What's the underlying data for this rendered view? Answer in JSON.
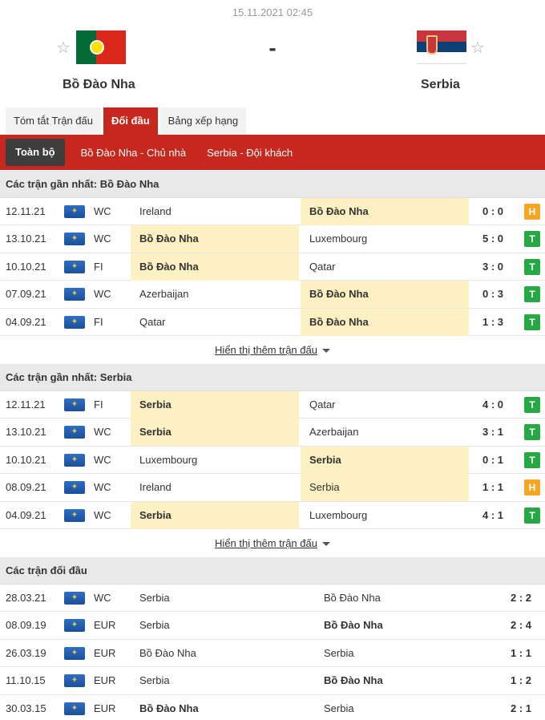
{
  "match": {
    "datetime": "15.11.2021 02:45",
    "home": "Bồ Đào Nha",
    "away": "Serbia",
    "separator": "-"
  },
  "tabs": [
    {
      "label": "Tóm tắt Trận đấu",
      "active": false
    },
    {
      "label": "Đối đầu",
      "active": true
    },
    {
      "label": "Bảng xếp hạng",
      "active": false
    }
  ],
  "subnav": [
    {
      "label": "Toàn bộ",
      "active": true
    },
    {
      "label": "Bồ Đào Nha - Chủ nhà",
      "active": false
    },
    {
      "label": "Serbia - Đội khách",
      "active": false
    }
  ],
  "sections": {
    "home_recent": {
      "title": "Các trận gần nhất: Bồ Đào Nha",
      "rows": [
        {
          "date": "12.11.21",
          "league": "WC",
          "home": "Ireland",
          "away": "Bồ Đào Nha",
          "score": "0 : 0",
          "result": "H",
          "highlight": "away"
        },
        {
          "date": "13.10.21",
          "league": "WC",
          "home": "Bồ Đào Nha",
          "away": "Luxembourg",
          "score": "5 : 0",
          "result": "T",
          "highlight": "home"
        },
        {
          "date": "10.10.21",
          "league": "FI",
          "home": "Bồ Đào Nha",
          "away": "Qatar",
          "score": "3 : 0",
          "result": "T",
          "highlight": "home"
        },
        {
          "date": "07.09.21",
          "league": "WC",
          "home": "Azerbaijan",
          "away": "Bồ Đào Nha",
          "score": "0 : 3",
          "result": "T",
          "highlight": "away"
        },
        {
          "date": "04.09.21",
          "league": "FI",
          "home": "Qatar",
          "away": "Bồ Đào Nha",
          "score": "1 : 3",
          "result": "T",
          "highlight": "away"
        }
      ],
      "more": "Hiển thị thêm trận đấu"
    },
    "away_recent": {
      "title": "Các trận gần nhất: Serbia",
      "rows": [
        {
          "date": "12.11.21",
          "league": "FI",
          "home": "Serbia",
          "away": "Qatar",
          "score": "4 : 0",
          "result": "T",
          "highlight": "home"
        },
        {
          "date": "13.10.21",
          "league": "WC",
          "home": "Serbia",
          "away": "Azerbaijan",
          "score": "3 : 1",
          "result": "T",
          "highlight": "home"
        },
        {
          "date": "10.10.21",
          "league": "WC",
          "home": "Luxembourg",
          "away": "Serbia",
          "score": "0 : 1",
          "result": "T",
          "highlight": "away"
        },
        {
          "date": "08.09.21",
          "league": "WC",
          "home": "Ireland",
          "away": "Serbia",
          "score": "1 : 1",
          "result": "H",
          "highlight": "away-light"
        },
        {
          "date": "04.09.21",
          "league": "WC",
          "home": "Serbia",
          "away": "Luxembourg",
          "score": "4 : 1",
          "result": "T",
          "highlight": "home"
        }
      ],
      "more": "Hiển thị thêm trận đấu"
    },
    "h2h": {
      "title": "Các trận đối đầu",
      "rows": [
        {
          "date": "28.03.21",
          "league": "WC",
          "home": "Serbia",
          "away": "Bồ Đào Nha",
          "score": "2 : 2",
          "bold": ""
        },
        {
          "date": "08.09.19",
          "league": "EUR",
          "home": "Serbia",
          "away": "Bồ Đào Nha",
          "score": "2 : 4",
          "bold": "away"
        },
        {
          "date": "26.03.19",
          "league": "EUR",
          "home": "Bồ Đào Nha",
          "away": "Serbia",
          "score": "1 : 1",
          "bold": ""
        },
        {
          "date": "11.10.15",
          "league": "EUR",
          "home": "Serbia",
          "away": "Bồ Đào Nha",
          "score": "1 : 2",
          "bold": "away"
        },
        {
          "date": "30.03.15",
          "league": "EUR",
          "home": "Bồ Đào Nha",
          "away": "Serbia",
          "score": "2 : 1",
          "bold": "home"
        }
      ]
    }
  },
  "icons": {
    "star": "star-outline-icon",
    "league": "league-badge-icon",
    "caret": "caret-down-icon"
  },
  "colors": {
    "accent": "#c6281e",
    "subnav_active": "#3e3e3e",
    "highlight": "#fdf0c2",
    "win": "#27a844",
    "draw": "#f5a623"
  }
}
